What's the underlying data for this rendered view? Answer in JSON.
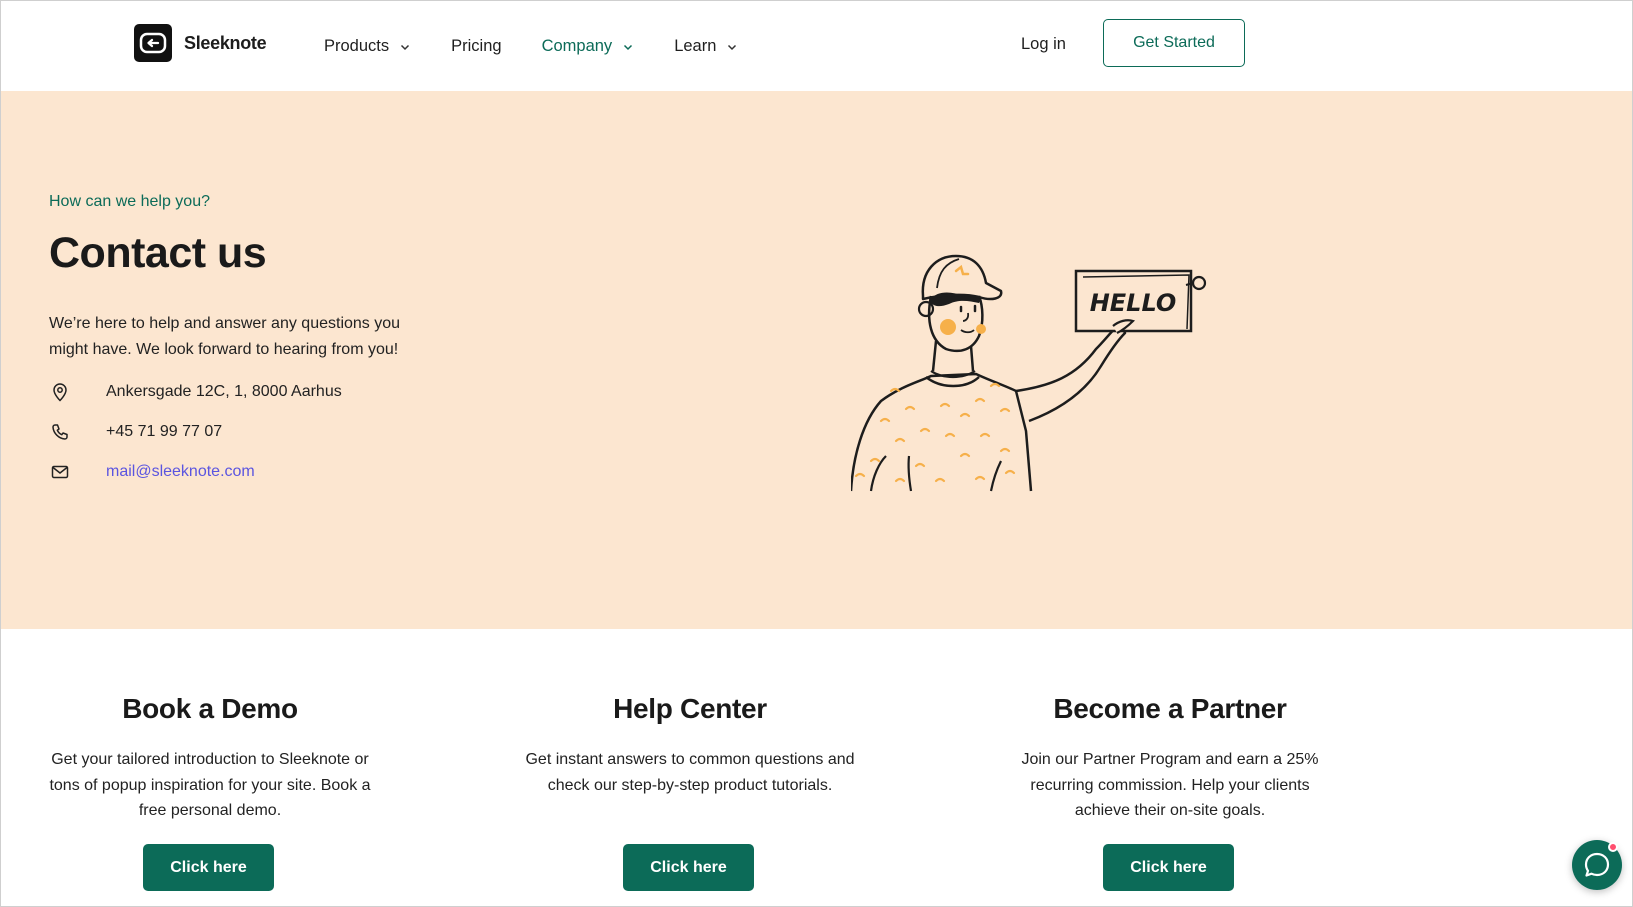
{
  "header": {
    "brand": "Sleeknote",
    "nav": [
      {
        "label": "Products",
        "has_dropdown": true,
        "active": false
      },
      {
        "label": "Pricing",
        "has_dropdown": false,
        "active": false
      },
      {
        "label": "Company",
        "has_dropdown": true,
        "active": true
      },
      {
        "label": "Learn",
        "has_dropdown": true,
        "active": false
      }
    ],
    "login_label": "Log in",
    "cta_label": "Get Started"
  },
  "hero": {
    "eyebrow": "How can we help you?",
    "title": "Contact us",
    "description": "We’re here to help and answer any questions you might have. We look forward to hearing from you!",
    "address": "Ankersgade 12C, 1, 8000 Aarhus",
    "phone": "+45 71 99 77 07",
    "email": "mail@sleeknote.com",
    "illustration_sign": "HELLO"
  },
  "cards": [
    {
      "title": "Book a Demo",
      "text": "Get your tailored introduction to Sleeknote or tons of popup inspiration for your site. Book a free personal demo.",
      "button": "Click here"
    },
    {
      "title": "Help Center",
      "text": "Get instant answers to common questions and check our step-by-step product tutorials.",
      "button": "Click here"
    },
    {
      "title": "Become a Partner",
      "text": "Join our Partner Program and earn a 25% recurring commission. Help your clients achieve their on-site goals.",
      "button": "Click here"
    }
  ],
  "icons": {
    "address": "location-pin-icon",
    "phone": "phone-icon",
    "email": "envelope-icon",
    "chat": "chat-bubble-icon"
  },
  "colors": {
    "brand_green": "#0c6b58",
    "hero_bg": "#fce6d0",
    "link": "#5b55e0",
    "notification": "#ff4d6d"
  }
}
